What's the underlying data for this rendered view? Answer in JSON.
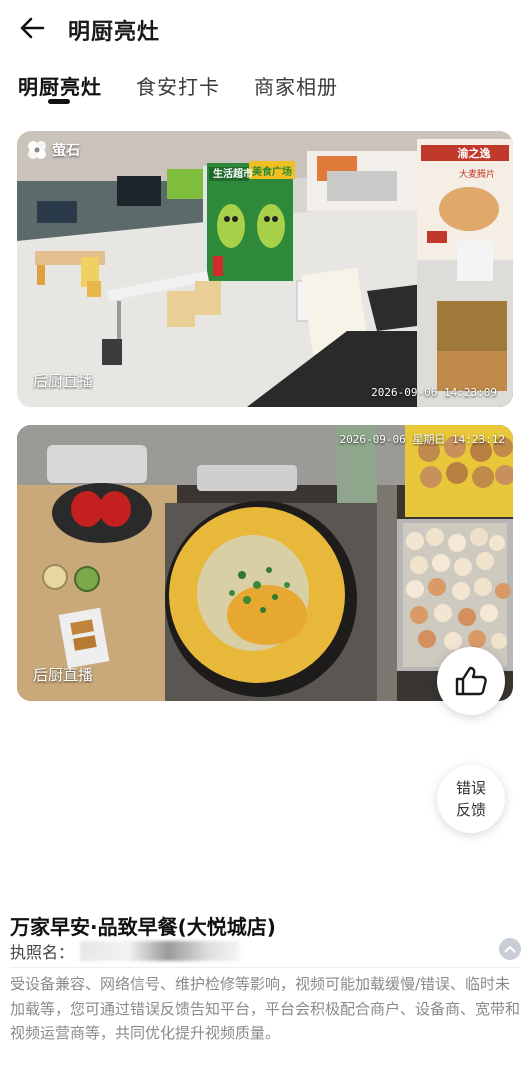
{
  "header": {
    "title": "明厨亮灶",
    "back_icon": "arrow-left-icon"
  },
  "tabs": [
    {
      "label": "明厨亮灶",
      "active": true
    },
    {
      "label": "食安打卡",
      "active": false
    },
    {
      "label": "商家相册",
      "active": false
    }
  ],
  "videos": [
    {
      "label": "后厨直播",
      "timestamp": "2026-09-06 14:23:09",
      "camera_brand": "萤石",
      "signage": [
        "生活超市",
        "美食广场",
        "渝之逸",
        "大麦腾片"
      ]
    },
    {
      "label": "后厨直播",
      "timestamp": "2026-09-06 星期日 14:23:12"
    }
  ],
  "actions": {
    "like_icon": "thumbs-up-icon",
    "feedback_label_line1": "错误",
    "feedback_label_line2": "反馈"
  },
  "store": {
    "name": "万家早安·品致早餐(大悦城店)",
    "license_label": "执照名：",
    "collapse_icon": "chevron-up-icon"
  },
  "notice": "受设备兼容、网络信号、维护检修等影响，视频可能加载缓慢/错误、临时未加载等，您可通过错误反馈告知平台，平台会积极配合商户、设备商、宽带和视频运营商等，共同优化提升视频质量。",
  "colors": {
    "accent": "#111111",
    "muted_text": "#8a8a8a",
    "collapse_bg": "#c9ced6"
  }
}
